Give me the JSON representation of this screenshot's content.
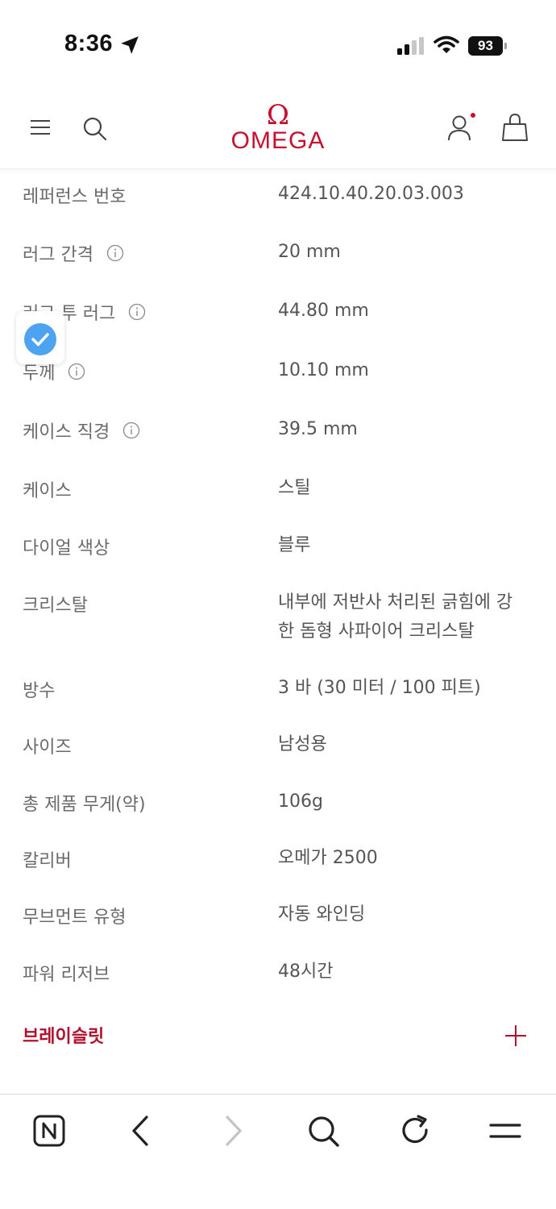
{
  "status_bar": {
    "time": "8:36",
    "battery": "93"
  },
  "header": {
    "logo_symbol": "Ω",
    "logo_text": "OMEGA",
    "icons": [
      "menu-icon",
      "search-icon",
      "user-icon",
      "bag-icon"
    ],
    "brand_color": "#c8102e"
  },
  "specs": [
    {
      "label": "레퍼런스 번호",
      "value": "424.10.40.20.03.003",
      "info": false
    },
    {
      "label": "러그 간격",
      "value": "20 mm",
      "info": true
    },
    {
      "label": "러그 투 러그",
      "value": "44.80 mm",
      "info": true
    },
    {
      "label": "두께",
      "value": "10.10 mm",
      "info": true
    },
    {
      "label": "케이스 직경",
      "value": "39.5 mm",
      "info": true
    },
    {
      "label": "케이스",
      "value": "스틸",
      "info": false
    },
    {
      "label": "다이얼 색상",
      "value": "블루",
      "info": false
    },
    {
      "label": "크리스탈",
      "value": "내부에 저반사 처리된 긁힘에 강한 돔형 사파이어 크리스탈",
      "info": false
    },
    {
      "label": "방수",
      "value": "3 바 (30 미터 / 100 피트)",
      "info": false
    },
    {
      "label": "사이즈",
      "value": "남성용",
      "info": false
    },
    {
      "label": "총 제품 무게(약)",
      "value": "106g",
      "info": false
    },
    {
      "label": "칼리버",
      "value": "오메가 2500",
      "info": false
    },
    {
      "label": "무브먼트 유형",
      "value": "자동 와인딩",
      "info": false
    },
    {
      "label": "파워 리저브",
      "value": "48시간",
      "info": false
    }
  ],
  "bracelet": {
    "label": "브레이슬릿",
    "color": "#b0102d"
  },
  "toolbar": {
    "icons": [
      "naver-n-icon",
      "back-arrow-icon",
      "forward-arrow-icon",
      "search-icon",
      "reload-icon",
      "menu-icon"
    ]
  }
}
